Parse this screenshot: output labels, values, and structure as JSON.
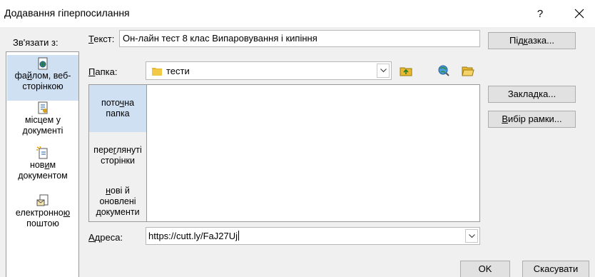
{
  "dialog": {
    "title": "Додавання гіперпосилання",
    "help_glyph": "?",
    "close_glyph": "✕"
  },
  "link_to": {
    "label": "Зв'язати з:",
    "items": [
      {
        "pre": "фа",
        "u": "й",
        "post": "лом, веб-сторінкою",
        "icon": "web-page-icon",
        "selected": true
      },
      {
        "pre": "місцем у документі",
        "u": "",
        "post": "",
        "icon": "place-in-document-icon",
        "selected": false
      },
      {
        "pre": "нов",
        "u": "и",
        "post": "м документом",
        "icon": "new-document-icon",
        "selected": false
      },
      {
        "pre": "електронно",
        "u": "ю",
        "post": " поштою",
        "icon": "email-icon",
        "selected": false
      }
    ]
  },
  "text_field": {
    "label_u": "Т",
    "label_rest": "екст:",
    "value": "Он-лайн тест 8 клас Випаровування і кипіння"
  },
  "hint_button": {
    "pre": "Під",
    "u": "к",
    "post": "азка..."
  },
  "folder": {
    "label_u": "П",
    "label_rest": "апка:",
    "value": "тести",
    "folder_icon": "folder-icon",
    "dropdown_icon": "chevron-down-icon",
    "tools": [
      {
        "name": "up-folder-icon"
      },
      {
        "name": "browse-web-icon"
      },
      {
        "name": "browse-file-icon"
      }
    ]
  },
  "browse": {
    "items": [
      {
        "pre": "пото",
        "u": "ч",
        "post": "на папка",
        "selected": true
      },
      {
        "pre": "пере",
        "u": "г",
        "post": "лянуті сторінки",
        "selected": false
      },
      {
        "pre": "",
        "u": "н",
        "post": "ові й оновлені документи",
        "selected": false
      }
    ]
  },
  "bookmark_button": {
    "pre": "Закла",
    "u": "д",
    "post": "ка..."
  },
  "frame_button": {
    "pre": "",
    "u": "В",
    "post": "ибір рамки..."
  },
  "address": {
    "label_u": "А",
    "label_rest": "дреса:",
    "value": "https://cutt.ly/FaJ27Uj",
    "dropdown_icon": "chevron-down-icon"
  },
  "ok_label": "OK",
  "cancel_label": "Скасувати"
}
